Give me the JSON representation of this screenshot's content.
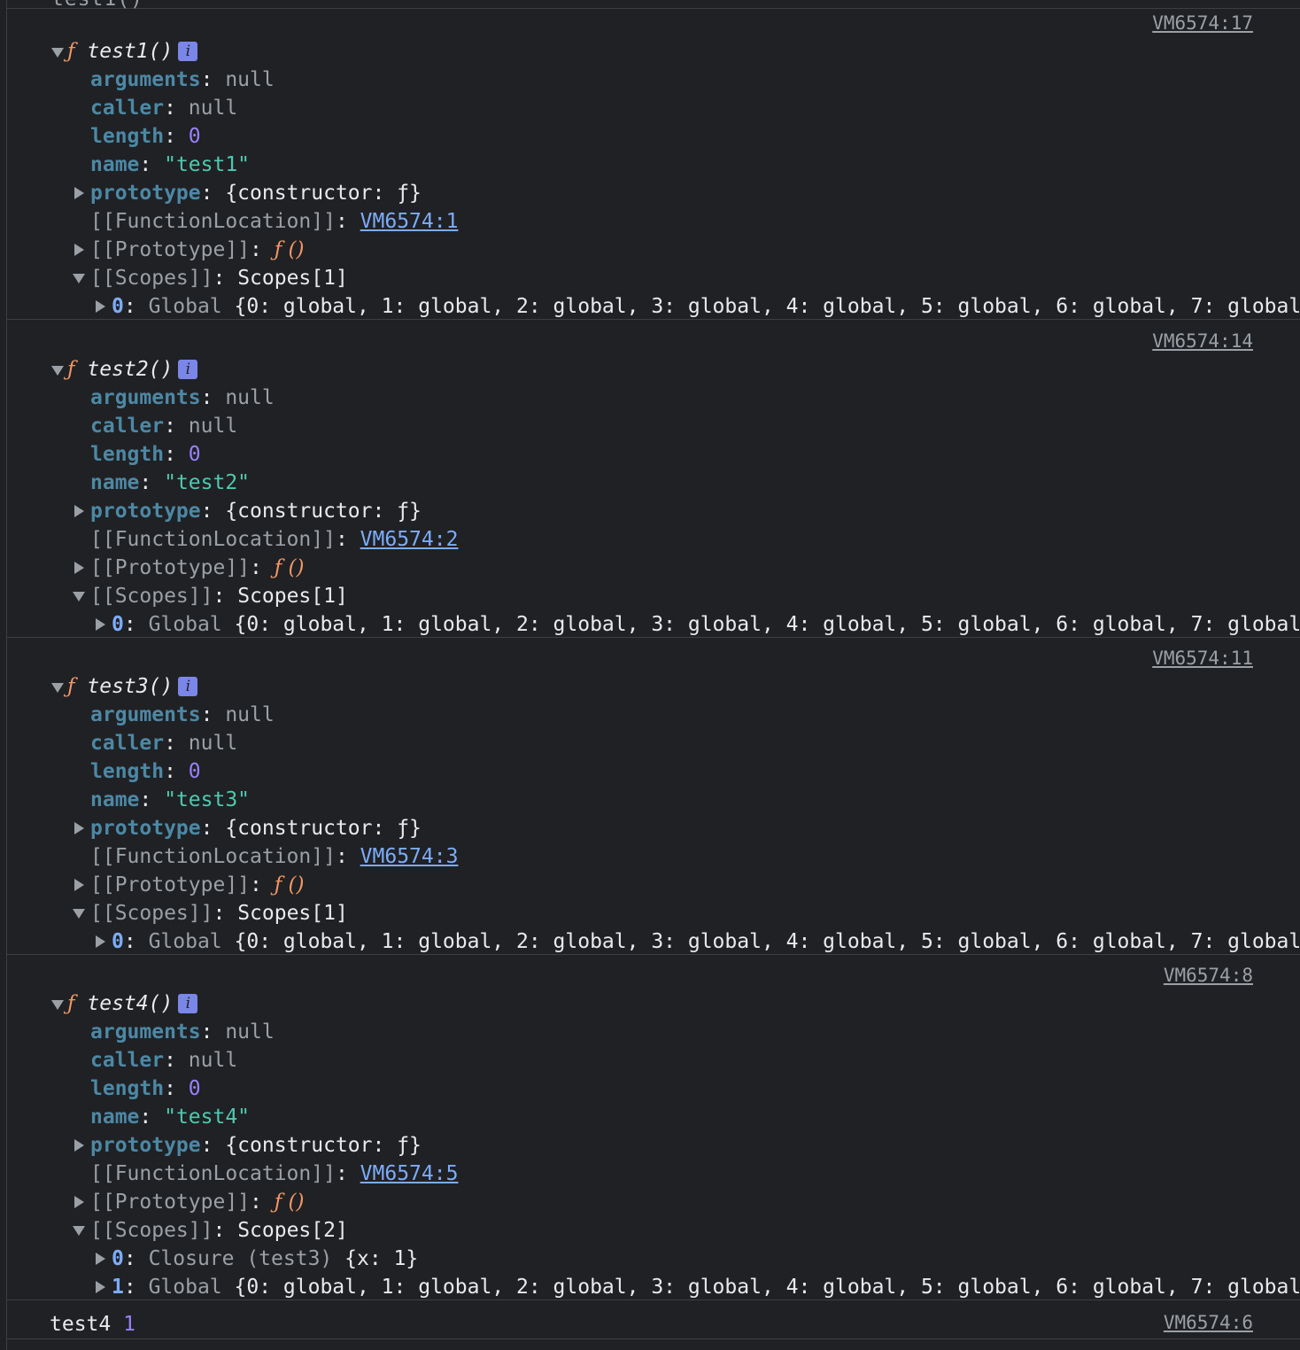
{
  "top_clip": "test1()",
  "blocks": [
    {
      "source": "VM6574:17",
      "fn_keyword": "ƒ",
      "fn_name": "test1()",
      "info_icon": "i",
      "arguments": "null",
      "caller": "null",
      "length": "0",
      "name_value": "\"test1\"",
      "prototype_value": "{constructor: ƒ}",
      "function_location": "VM6574:1",
      "proto_value": "ƒ ()",
      "scopes_label": "Scopes[1]",
      "scopes": [
        {
          "index": "0",
          "type": "Global",
          "preview": "{0: global, 1: global, 2: global, 3: global, 4: global, 5: global, 6: global, 7: global,"
        }
      ]
    },
    {
      "source": "VM6574:14",
      "fn_keyword": "ƒ",
      "fn_name": "test2()",
      "info_icon": "i",
      "arguments": "null",
      "caller": "null",
      "length": "0",
      "name_value": "\"test2\"",
      "prototype_value": "{constructor: ƒ}",
      "function_location": "VM6574:2",
      "proto_value": "ƒ ()",
      "scopes_label": "Scopes[1]",
      "scopes": [
        {
          "index": "0",
          "type": "Global",
          "preview": "{0: global, 1: global, 2: global, 3: global, 4: global, 5: global, 6: global, 7: global,"
        }
      ]
    },
    {
      "source": "VM6574:11",
      "fn_keyword": "ƒ",
      "fn_name": "test3()",
      "info_icon": "i",
      "arguments": "null",
      "caller": "null",
      "length": "0",
      "name_value": "\"test3\"",
      "prototype_value": "{constructor: ƒ}",
      "function_location": "VM6574:3",
      "proto_value": "ƒ ()",
      "scopes_label": "Scopes[1]",
      "scopes": [
        {
          "index": "0",
          "type": "Global",
          "preview": "{0: global, 1: global, 2: global, 3: global, 4: global, 5: global, 6: global, 7: global,"
        }
      ]
    },
    {
      "source": "VM6574:8",
      "fn_keyword": "ƒ",
      "fn_name": "test4()",
      "info_icon": "i",
      "arguments": "null",
      "caller": "null",
      "length": "0",
      "name_value": "\"test4\"",
      "prototype_value": "{constructor: ƒ}",
      "function_location": "VM6574:5",
      "proto_value": "ƒ ()",
      "scopes_label": "Scopes[2]",
      "scopes": [
        {
          "index": "0",
          "type": "Closure (test3)",
          "preview": "{x: 1}"
        },
        {
          "index": "1",
          "type": "Global",
          "preview": "{0: global, 1: global, 2: global, 3: global, 4: global, 5: global, 6: global, 7: global,"
        }
      ]
    }
  ],
  "last_log": {
    "text": "test4",
    "value": "1",
    "source": "VM6574:6"
  },
  "labels": {
    "arguments": "arguments",
    "caller": "caller",
    "length": "length",
    "name": "name",
    "prototype": "prototype",
    "function_location": "[[FunctionLocation]]",
    "proto": "[[Prototype]]",
    "scopes": "[[Scopes]]"
  },
  "colors": {
    "background": "#202124",
    "function_keyword": "#f29766",
    "string": "#4ec9b0",
    "number": "#9980ff",
    "link": "#7cacf8"
  }
}
